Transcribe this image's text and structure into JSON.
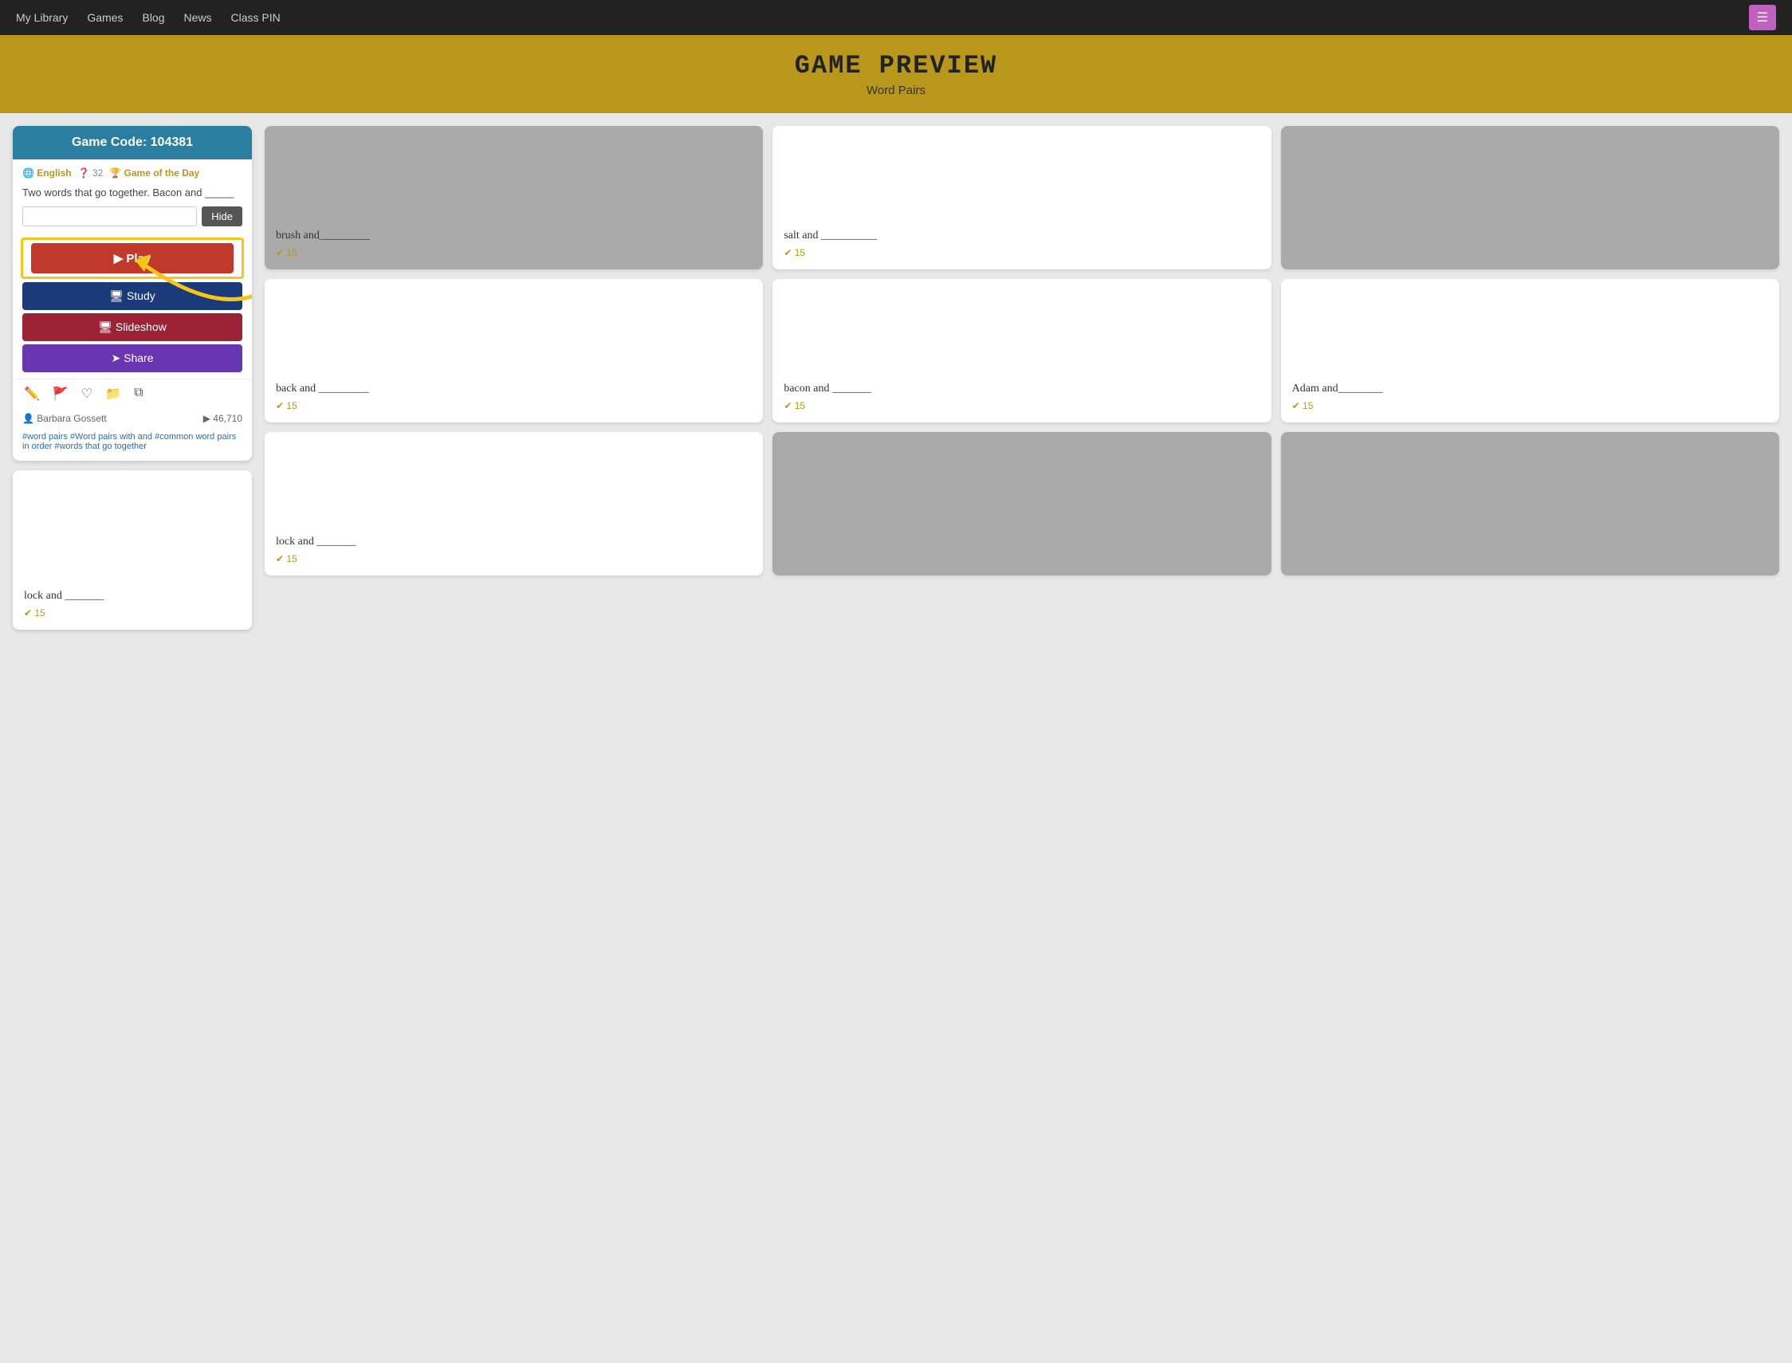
{
  "navbar": {
    "links": [
      "My Library",
      "Games",
      "Blog",
      "News",
      "Class PIN"
    ],
    "menu_icon": "☰"
  },
  "header": {
    "title": "Game Preview",
    "subtitle": "Word Pairs"
  },
  "sidebar": {
    "game_code_label": "Game Code: 104381",
    "meta_english": "🌐 English",
    "meta_count": "❓ 32",
    "meta_gotd": "🏆 Game of the Day",
    "description": "Two words that go together. Bacon and _____",
    "input_placeholder": "",
    "hide_label": "Hide",
    "play_label": "▶ Play",
    "study_label": "🖥 Study",
    "slideshow_label": "🖥 Slideshow",
    "share_label": "➤ Share",
    "author": "👤 Barbara Gossett",
    "plays": "▶ 46,710",
    "tags": "#word pairs #Word pairs with and #common word pairs in order #words that go together"
  },
  "tiles": [
    {
      "text": "brush and_________",
      "check": "✔ 15",
      "bg": "grey"
    },
    {
      "text": "salt and __________",
      "check": "✔ 15",
      "bg": "white"
    },
    {
      "text": "",
      "check": "",
      "bg": "grey"
    },
    {
      "text": "back and _________",
      "check": "✔ 15",
      "bg": "white"
    },
    {
      "text": "bacon and _______",
      "check": "✔ 15",
      "bg": "white"
    },
    {
      "text": "Adam and________",
      "check": "✔ 15",
      "bg": "white"
    },
    {
      "text": "lock and _______",
      "check": "✔ 15",
      "bg": "white"
    },
    {
      "text": "",
      "check": "",
      "bg": "grey"
    },
    {
      "text": "",
      "check": "",
      "bg": "grey"
    }
  ]
}
